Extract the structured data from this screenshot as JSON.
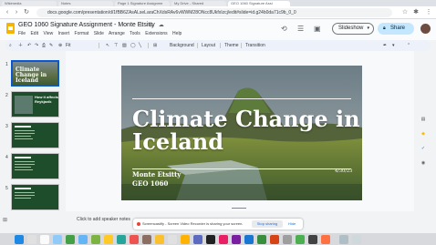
{
  "browser": {
    "tabs": [
      {
        "label": "Wikimedia",
        "active": false
      },
      {
        "label": "Notes",
        "active": false
      },
      {
        "label": "Page 1 Signature Assignme",
        "active": false
      },
      {
        "label": "My Drive - Shared",
        "active": false
      },
      {
        "label": "GEO 1060 Signature Assi",
        "active": true
      }
    ],
    "url": "docs.google.com/presentation/d/1fBB6ZAsALseLaraChXdsRAv6vWWM28ONcc8UkfxIzcj/edit#slide=id.g24b0da71c9b_0_0"
  },
  "header": {
    "doc_title": "GEO 1060 Signature Assignment - Monte Etsitty",
    "title_icons": "☆ ⊞ ☁",
    "menu": [
      "File",
      "Edit",
      "View",
      "Insert",
      "Format",
      "Slide",
      "Arrange",
      "Tools",
      "Extensions",
      "Help"
    ],
    "slideshow_label": "Slideshow",
    "share_label": "Share"
  },
  "toolbar": {
    "zoom": "Fit",
    "background_label": "Background",
    "layout_label": "Layout",
    "theme_label": "Theme",
    "transition_label": "Transition"
  },
  "filmstrip": {
    "slides": [
      {
        "number": "1",
        "title": "Climate Change in Iceland"
      },
      {
        "number": "2",
        "title": "How it affects Reykjavik"
      },
      {
        "number": "3",
        "title": ""
      },
      {
        "number": "4",
        "title": ""
      },
      {
        "number": "5",
        "title": ""
      }
    ]
  },
  "slide": {
    "title": "Climate Change in Iceland",
    "subtitle_line1": "Monte Etsitty",
    "subtitle_line2": "GEO 1060",
    "date": "4/30/23"
  },
  "notes": {
    "placeholder": "Click to add speaker notes"
  },
  "sharebar": {
    "message": "Screencastify - Screen Video Recorder is sharing your screen.",
    "stop_label": "Stop sharing",
    "hide_label": "Hide"
  },
  "colors": {
    "accent": "#0b57d0",
    "share_bg": "#c2e7ff",
    "thumb_green": "#1e4d2b"
  }
}
